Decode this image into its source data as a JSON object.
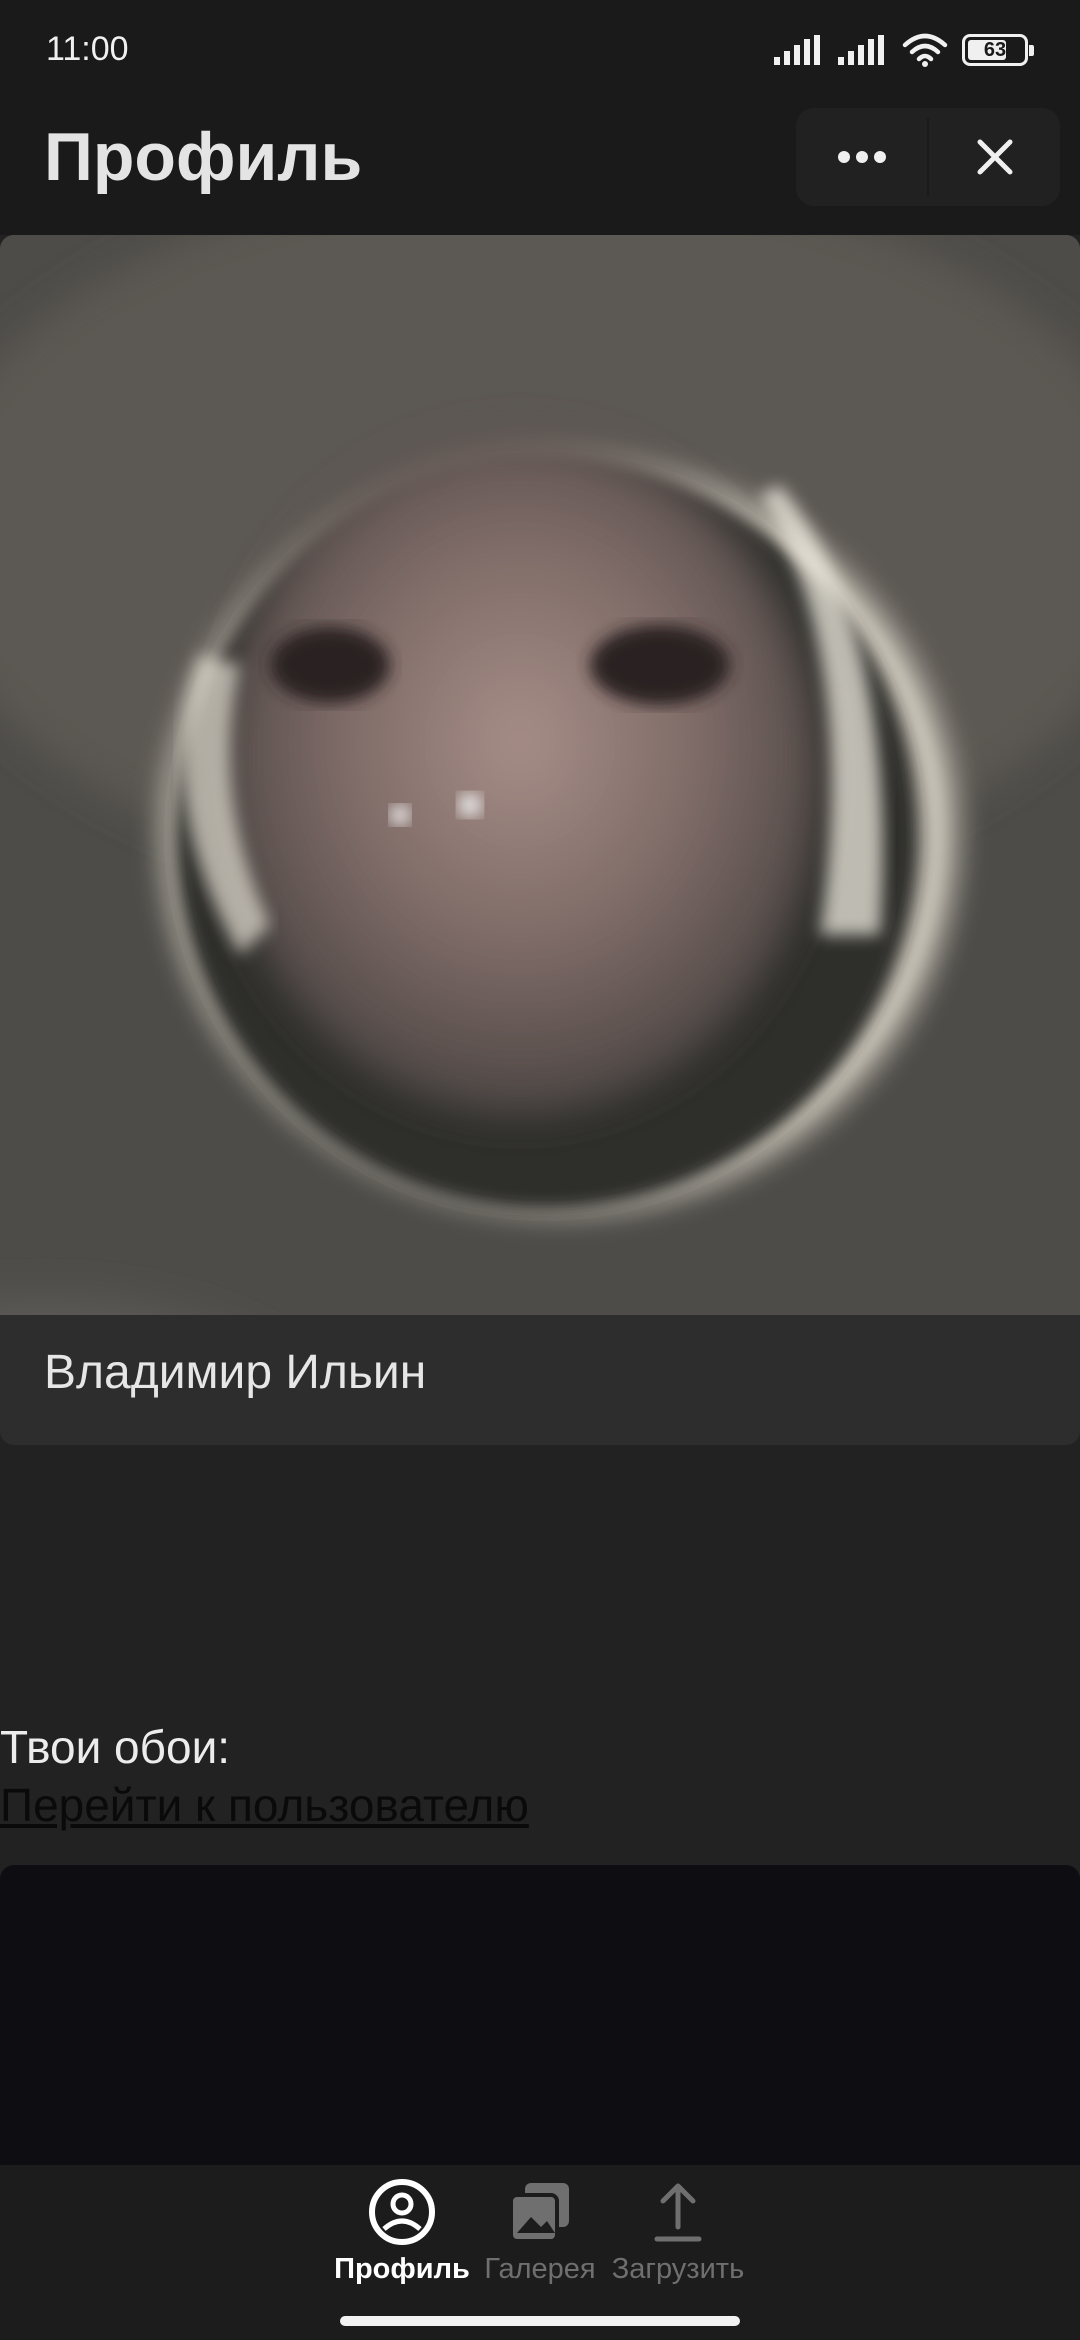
{
  "status_bar": {
    "time": "11:00",
    "battery_level": "63",
    "icons": [
      "signal-icon",
      "signal-icon",
      "wifi-icon",
      "battery-icon"
    ]
  },
  "header": {
    "title": "Профиль",
    "more_icon": "more-horizontal-icon",
    "close_icon": "close-icon"
  },
  "profile": {
    "name": "Владимир Ильин"
  },
  "wallpapers": {
    "title": "Твои обои:",
    "link": "Перейти к пользователю"
  },
  "bottom_nav": {
    "items": [
      {
        "label": "Профиль",
        "icon": "profile-icon",
        "active": true
      },
      {
        "label": "Галерея",
        "icon": "gallery-icon",
        "active": false
      },
      {
        "label": "Загрузить",
        "icon": "upload-icon",
        "active": false
      }
    ]
  },
  "colors": {
    "background": "#222222",
    "bar": "#1a1a1a",
    "card": "#2d2d2d",
    "active": "#ffffff",
    "inactive": "#6f6f6f"
  }
}
